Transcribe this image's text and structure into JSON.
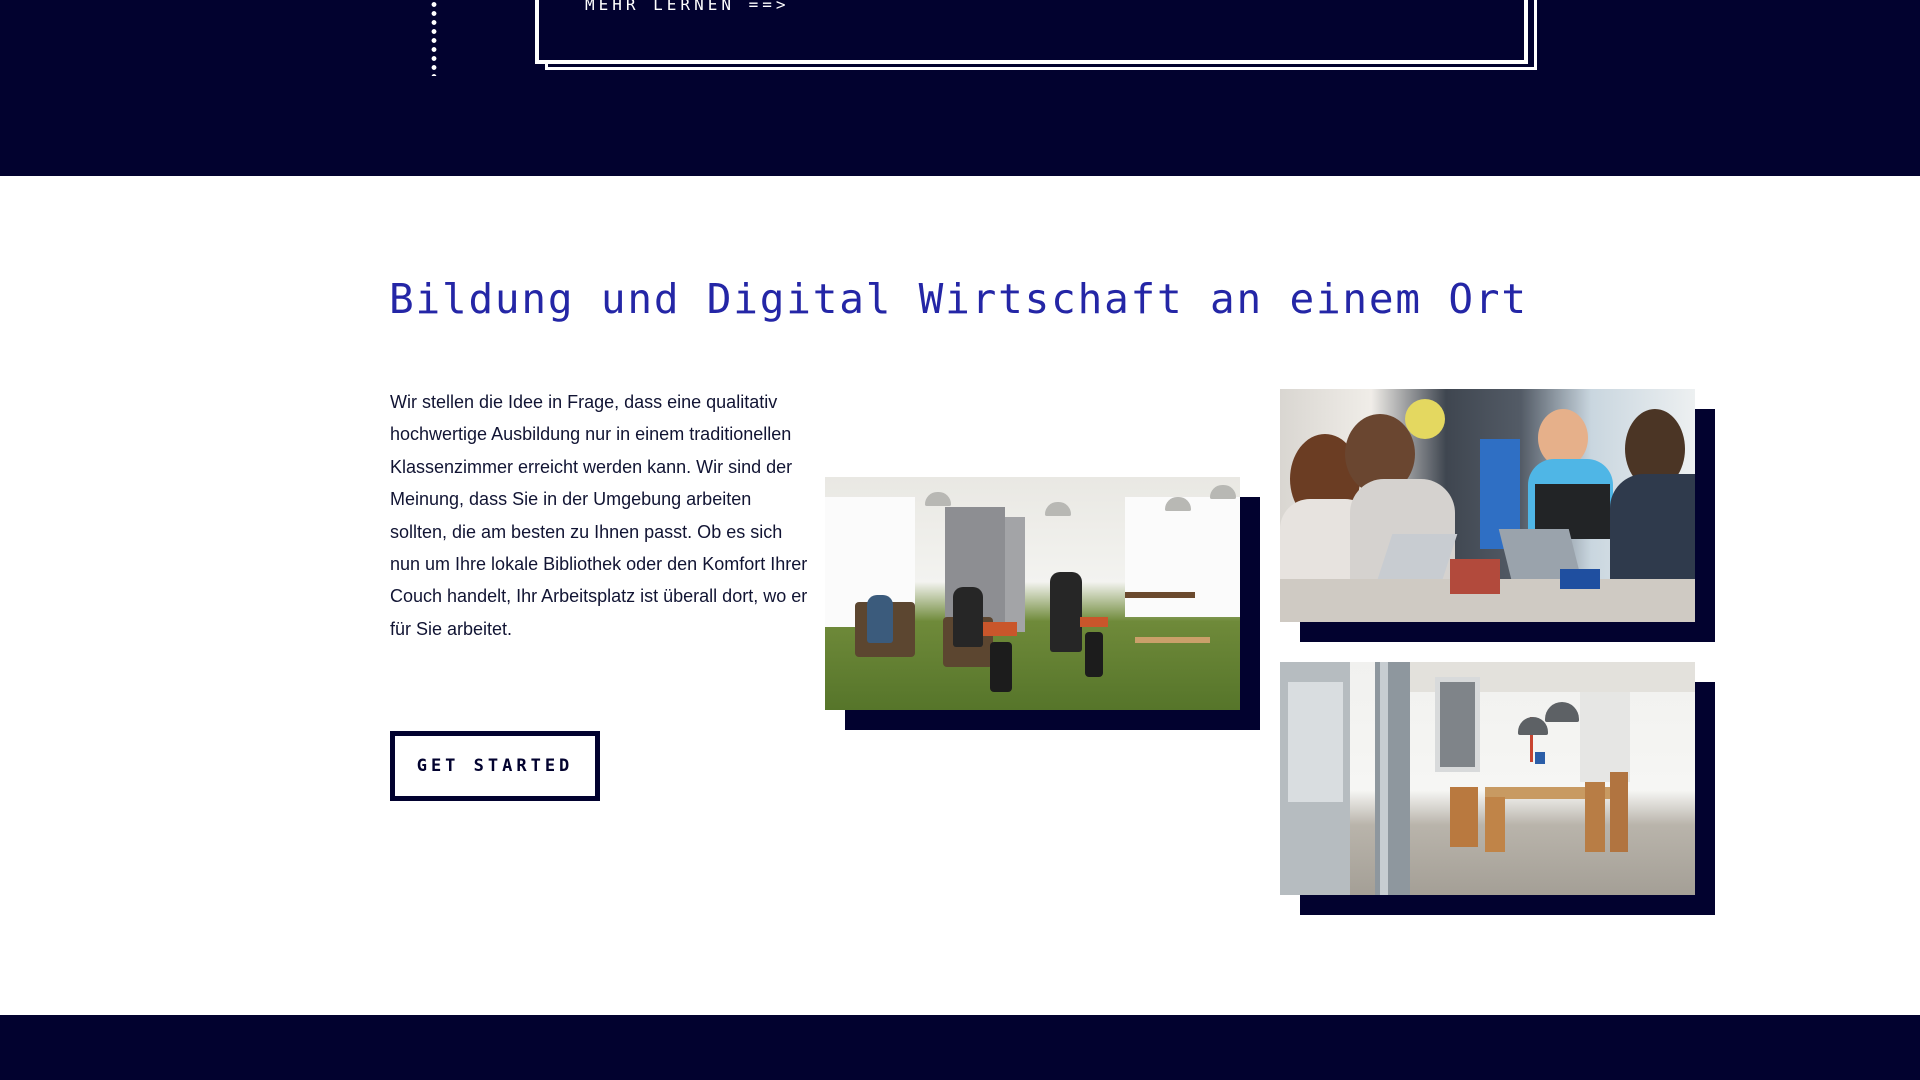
{
  "top_card": {
    "link_label": "MEHR LERNEN ==>"
  },
  "main": {
    "heading": "Bildung und Digital Wirtschaft an einem Ort",
    "intro": "Wir stellen die Idee in Frage, dass eine qualitativ hochwertige Ausbildung nur in einem traditionellen Klassenzimmer erreicht werden kann. Wir sind der Meinung, dass Sie in der Umgebung arbeiten sollten, die am besten zu Ihnen passt. Ob es sich nun um Ihre lokale Bibliothek oder den Komfort Ihrer Couch handelt, Ihr Arbeitsplatz ist überall dort, wo er für Sie arbeitet.",
    "cta_label": "GET STARTED"
  },
  "photos": [
    {
      "name": "lounge-photo"
    },
    {
      "name": "team-photo"
    },
    {
      "name": "meeting-room-photo"
    }
  ],
  "colors": {
    "navy": "#02022f",
    "heading_blue": "#2426a6",
    "text": "#111433",
    "white": "#ffffff"
  }
}
